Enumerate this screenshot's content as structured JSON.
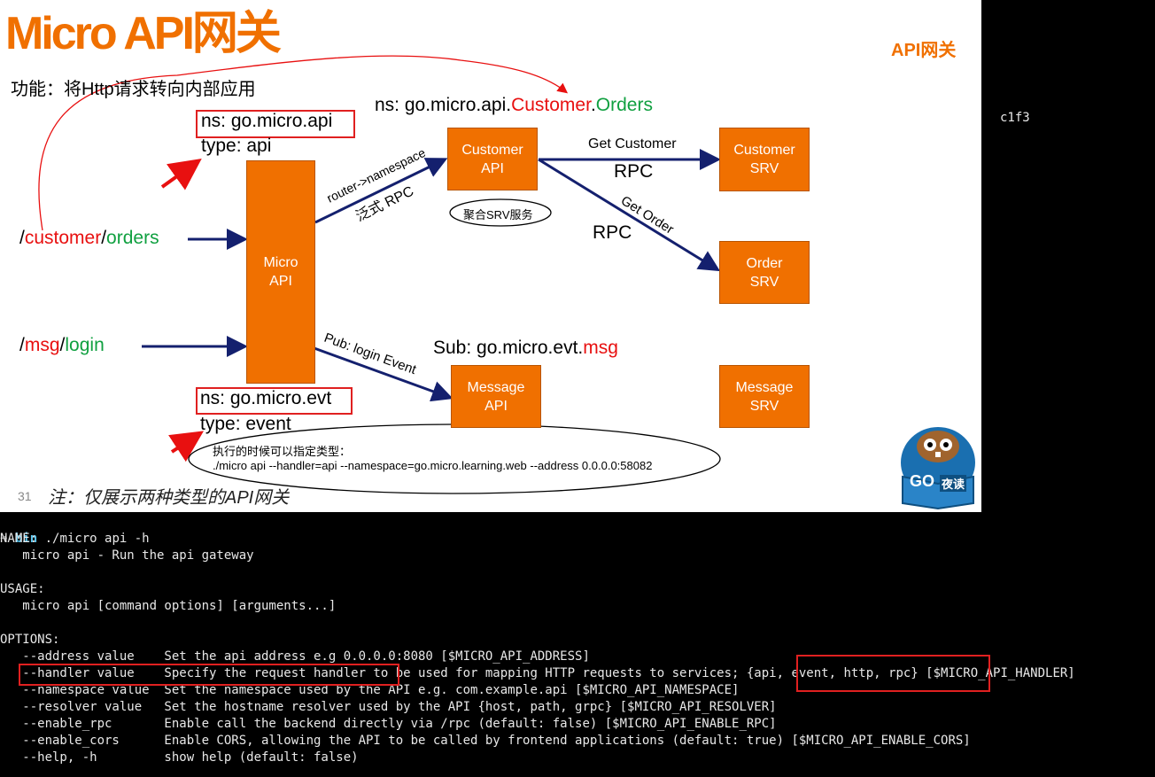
{
  "slide": {
    "title": "Micro API网关",
    "corner_label": "API网关",
    "function_text": "功能：将Http请求转向内部应用",
    "page_number": "31",
    "note": "注：仅展示两种类型的API网关",
    "ns_api_label": "ns: go.micro.api",
    "type_api_label": "type: api",
    "ns_evt_label": "ns: go.micro.evt",
    "type_evt_label": "type: event",
    "ns_orders_prefix": "ns: go.micro.api.",
    "ns_orders_customer": "Customer",
    "ns_orders_dot": ".",
    "ns_orders_orders": "Orders",
    "sub_prefix": "Sub: go.micro.evt.",
    "sub_msg": "msg",
    "route1_slash1": "/",
    "route1_customer": "customer",
    "route1_slash2": "/",
    "route1_orders": "orders",
    "route2_slash1": "/",
    "route2_msg": "msg",
    "route2_slash2": "/",
    "route2_login": "login",
    "micro_api_line1": "Micro",
    "micro_api_line2": "API",
    "customer_api_line1": "Customer",
    "customer_api_line2": "API",
    "customer_srv_line1": "Customer",
    "customer_srv_line2": "SRV",
    "order_srv_line1": "Order",
    "order_srv_line2": "SRV",
    "message_api_line1": "Message",
    "message_api_line2": "API",
    "message_srv_line1": "Message",
    "message_srv_line2": "SRV",
    "arrow_router_namespace": "router->namespace",
    "arrow_generic_rpc": "泛式 RPC",
    "get_customer": "Get Customer",
    "rpc_1": "RPC",
    "get_order": "Get Order",
    "rpc_2": "RPC",
    "aggregate_srv": "聚合SRV服务",
    "pub_login_event": "Pub: login Event",
    "exec_note_line1": "执行的时候可以指定类型：",
    "exec_note_line2": "./micro api --handler=api --namespace=go.micro.learning.web --address 0.0.0.0:58082",
    "logo_go": "GO",
    "logo_cn": "夜读"
  },
  "terminal": {
    "partial_text": "c1f3",
    "prompt_arrow": "➜",
    "prompt_dir": "bin",
    "command": "./micro api -h",
    "name_header": "NAME:",
    "name_text": "   micro api - Run the api gateway",
    "usage_header": "USAGE:",
    "usage_text": "   micro api [command options] [arguments...]",
    "options_header": "OPTIONS:",
    "options": [
      "   --address value    Set the api address e.g 0.0.0.0:8080 [$MICRO_API_ADDRESS]",
      "   --handler value    Specify the request handler to be used for mapping HTTP requests to services; {api, event, http, rpc} [$MICRO_API_HANDLER]",
      "   --namespace value  Set the namespace used by the API e.g. com.example.api [$MICRO_API_NAMESPACE]",
      "   --resolver value   Set the hostname resolver used by the API {host, path, grpc} [$MICRO_API_RESOLVER]",
      "   --enable_rpc       Enable call the backend directly via /rpc (default: false) [$MICRO_API_ENABLE_RPC]",
      "   --enable_cors      Enable CORS, allowing the API to be called by frontend applications (default: true) [$MICRO_API_ENABLE_CORS]",
      "   --help, -h         show help (default: false)"
    ]
  }
}
